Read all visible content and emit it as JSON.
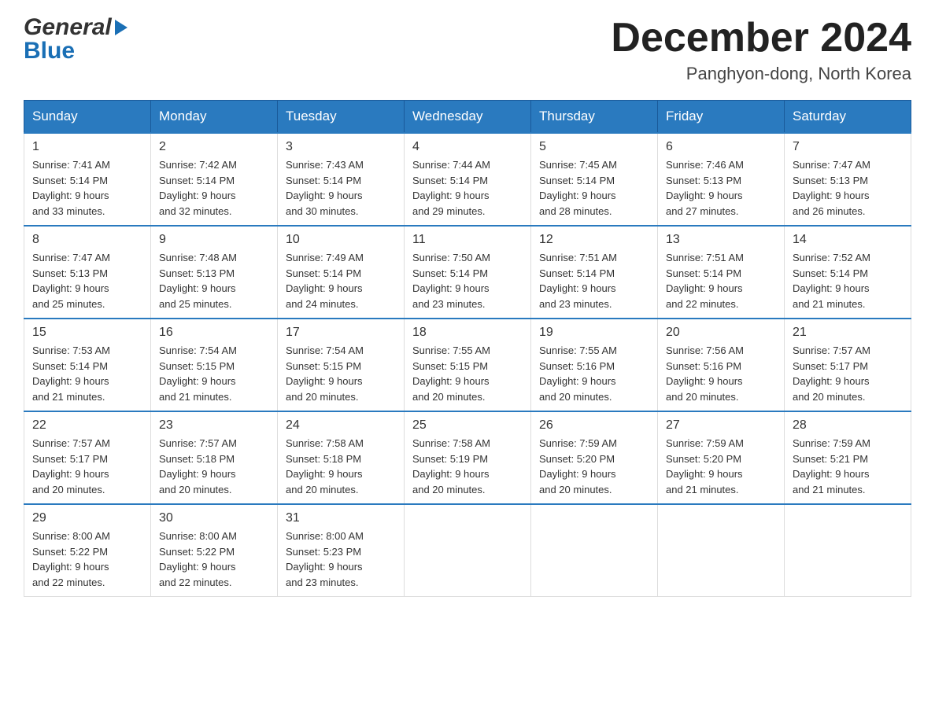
{
  "header": {
    "month_title": "December 2024",
    "location": "Panghyon-dong, North Korea"
  },
  "weekdays": [
    "Sunday",
    "Monday",
    "Tuesday",
    "Wednesday",
    "Thursday",
    "Friday",
    "Saturday"
  ],
  "weeks": [
    [
      {
        "day": "1",
        "sunrise": "7:41 AM",
        "sunset": "5:14 PM",
        "daylight": "9 hours and 33 minutes."
      },
      {
        "day": "2",
        "sunrise": "7:42 AM",
        "sunset": "5:14 PM",
        "daylight": "9 hours and 32 minutes."
      },
      {
        "day": "3",
        "sunrise": "7:43 AM",
        "sunset": "5:14 PM",
        "daylight": "9 hours and 30 minutes."
      },
      {
        "day": "4",
        "sunrise": "7:44 AM",
        "sunset": "5:14 PM",
        "daylight": "9 hours and 29 minutes."
      },
      {
        "day": "5",
        "sunrise": "7:45 AM",
        "sunset": "5:14 PM",
        "daylight": "9 hours and 28 minutes."
      },
      {
        "day": "6",
        "sunrise": "7:46 AM",
        "sunset": "5:13 PM",
        "daylight": "9 hours and 27 minutes."
      },
      {
        "day": "7",
        "sunrise": "7:47 AM",
        "sunset": "5:13 PM",
        "daylight": "9 hours and 26 minutes."
      }
    ],
    [
      {
        "day": "8",
        "sunrise": "7:47 AM",
        "sunset": "5:13 PM",
        "daylight": "9 hours and 25 minutes."
      },
      {
        "day": "9",
        "sunrise": "7:48 AM",
        "sunset": "5:13 PM",
        "daylight": "9 hours and 25 minutes."
      },
      {
        "day": "10",
        "sunrise": "7:49 AM",
        "sunset": "5:14 PM",
        "daylight": "9 hours and 24 minutes."
      },
      {
        "day": "11",
        "sunrise": "7:50 AM",
        "sunset": "5:14 PM",
        "daylight": "9 hours and 23 minutes."
      },
      {
        "day": "12",
        "sunrise": "7:51 AM",
        "sunset": "5:14 PM",
        "daylight": "9 hours and 23 minutes."
      },
      {
        "day": "13",
        "sunrise": "7:51 AM",
        "sunset": "5:14 PM",
        "daylight": "9 hours and 22 minutes."
      },
      {
        "day": "14",
        "sunrise": "7:52 AM",
        "sunset": "5:14 PM",
        "daylight": "9 hours and 21 minutes."
      }
    ],
    [
      {
        "day": "15",
        "sunrise": "7:53 AM",
        "sunset": "5:14 PM",
        "daylight": "9 hours and 21 minutes."
      },
      {
        "day": "16",
        "sunrise": "7:54 AM",
        "sunset": "5:15 PM",
        "daylight": "9 hours and 21 minutes."
      },
      {
        "day": "17",
        "sunrise": "7:54 AM",
        "sunset": "5:15 PM",
        "daylight": "9 hours and 20 minutes."
      },
      {
        "day": "18",
        "sunrise": "7:55 AM",
        "sunset": "5:15 PM",
        "daylight": "9 hours and 20 minutes."
      },
      {
        "day": "19",
        "sunrise": "7:55 AM",
        "sunset": "5:16 PM",
        "daylight": "9 hours and 20 minutes."
      },
      {
        "day": "20",
        "sunrise": "7:56 AM",
        "sunset": "5:16 PM",
        "daylight": "9 hours and 20 minutes."
      },
      {
        "day": "21",
        "sunrise": "7:57 AM",
        "sunset": "5:17 PM",
        "daylight": "9 hours and 20 minutes."
      }
    ],
    [
      {
        "day": "22",
        "sunrise": "7:57 AM",
        "sunset": "5:17 PM",
        "daylight": "9 hours and 20 minutes."
      },
      {
        "day": "23",
        "sunrise": "7:57 AM",
        "sunset": "5:18 PM",
        "daylight": "9 hours and 20 minutes."
      },
      {
        "day": "24",
        "sunrise": "7:58 AM",
        "sunset": "5:18 PM",
        "daylight": "9 hours and 20 minutes."
      },
      {
        "day": "25",
        "sunrise": "7:58 AM",
        "sunset": "5:19 PM",
        "daylight": "9 hours and 20 minutes."
      },
      {
        "day": "26",
        "sunrise": "7:59 AM",
        "sunset": "5:20 PM",
        "daylight": "9 hours and 20 minutes."
      },
      {
        "day": "27",
        "sunrise": "7:59 AM",
        "sunset": "5:20 PM",
        "daylight": "9 hours and 21 minutes."
      },
      {
        "day": "28",
        "sunrise": "7:59 AM",
        "sunset": "5:21 PM",
        "daylight": "9 hours and 21 minutes."
      }
    ],
    [
      {
        "day": "29",
        "sunrise": "8:00 AM",
        "sunset": "5:22 PM",
        "daylight": "9 hours and 22 minutes."
      },
      {
        "day": "30",
        "sunrise": "8:00 AM",
        "sunset": "5:22 PM",
        "daylight": "9 hours and 22 minutes."
      },
      {
        "day": "31",
        "sunrise": "8:00 AM",
        "sunset": "5:23 PM",
        "daylight": "9 hours and 23 minutes."
      },
      null,
      null,
      null,
      null
    ]
  ],
  "labels": {
    "sunrise": "Sunrise:",
    "sunset": "Sunset:",
    "daylight": "Daylight:"
  }
}
